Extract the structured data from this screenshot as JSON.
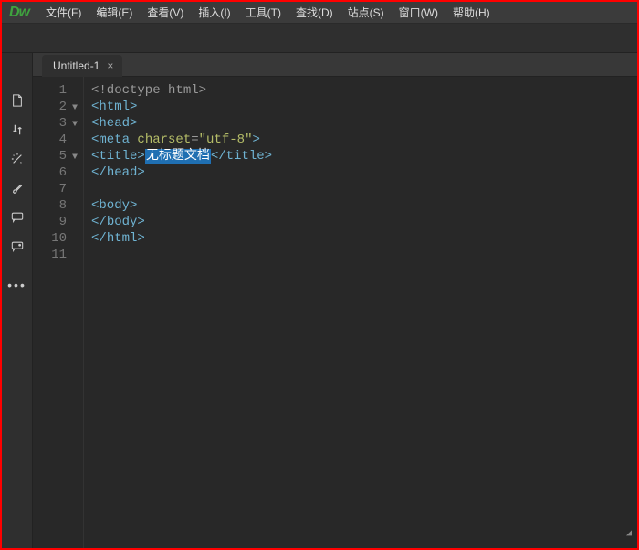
{
  "logo": "Dw",
  "menu": [
    "文件(F)",
    "编辑(E)",
    "查看(V)",
    "插入(I)",
    "工具(T)",
    "查找(D)",
    "站点(S)",
    "窗口(W)",
    "帮助(H)"
  ],
  "tabs": [
    {
      "label": "Untitled-1",
      "close": "×"
    }
  ],
  "side_icons": [
    "file",
    "swap",
    "wand",
    "brush",
    "comment",
    "db-comment",
    "dots"
  ],
  "gutter": {
    "lines": [
      "1",
      "2",
      "3",
      "4",
      "5",
      "6",
      "7",
      "8",
      "9",
      "10",
      "11"
    ],
    "fold_at": [
      2,
      3,
      5
    ]
  },
  "code": {
    "l1": {
      "doctype": "<!doctype html>"
    },
    "l2": {
      "open": "<",
      "tag": "html",
      "close": ">"
    },
    "l3": {
      "open": "<",
      "tag": "head",
      "close": ">"
    },
    "l4": {
      "open": "<",
      "tag": "meta",
      "sp": " ",
      "attr": "charset",
      "eq": "=",
      "q1": "\"",
      "val": "utf-8",
      "q2": "\"",
      "close": ">"
    },
    "l5": {
      "open1": "<",
      "tag1": "title",
      "close1": ">",
      "text": "无标题文档",
      "open2": "</",
      "tag2": "title",
      "close2": ">"
    },
    "l6": {
      "open": "</",
      "tag": "head",
      "close": ">"
    },
    "l7": {
      "blank": ""
    },
    "l8": {
      "open": "<",
      "tag": "body",
      "close": ">"
    },
    "l9": {
      "open": "</",
      "tag": "body",
      "close": ">"
    },
    "l10": {
      "open": "</",
      "tag": "html",
      "close": ">"
    },
    "l11": {
      "blank": ""
    }
  }
}
